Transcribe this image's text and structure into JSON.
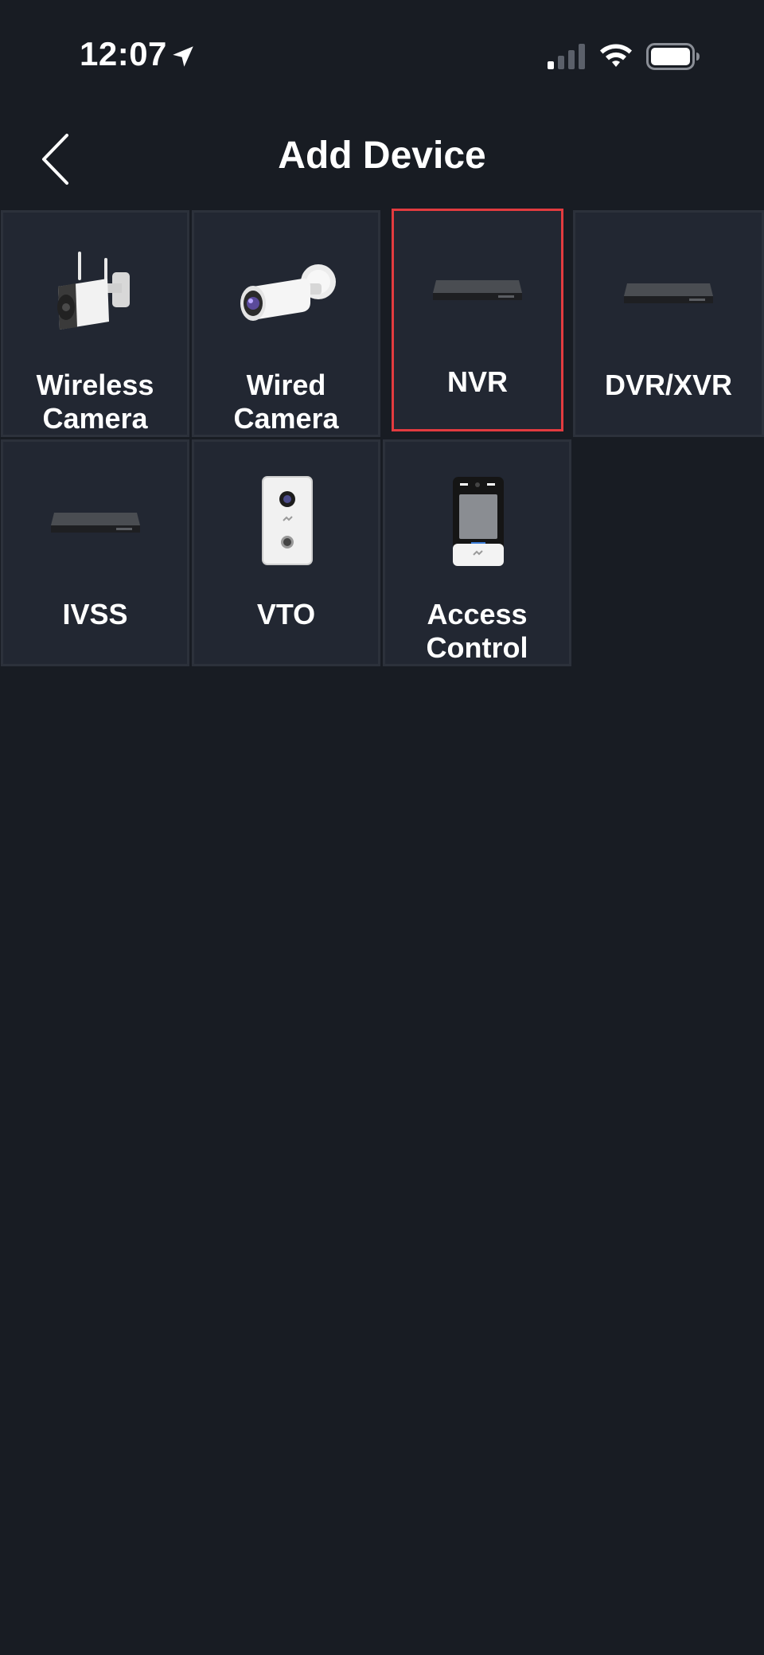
{
  "status_bar": {
    "time": "12:07",
    "icons": [
      "location-arrow-icon",
      "cellular-signal-icon",
      "wifi-icon",
      "battery-icon"
    ]
  },
  "header": {
    "title": "Add Device",
    "back_icon": "chevron-left-icon"
  },
  "devices": [
    {
      "label": "Wireless\nCamera",
      "icon": "wireless-camera-icon",
      "selected": false
    },
    {
      "label": "Wired\nCamera",
      "icon": "wired-camera-icon",
      "selected": false
    },
    {
      "label": "NVR",
      "icon": "nvr-icon",
      "selected": true
    },
    {
      "label": "DVR/XVR",
      "icon": "dvr-xvr-icon",
      "selected": false
    },
    {
      "label": "IVSS",
      "icon": "ivss-icon",
      "selected": false
    },
    {
      "label": "VTO",
      "icon": "vto-icon",
      "selected": false
    },
    {
      "label": "Access\nControl",
      "icon": "access-control-icon",
      "selected": false
    }
  ],
  "colors": {
    "background": "#181c23",
    "tile": "#222732",
    "tile_border": "#2c313b",
    "selected_border": "#e23b3f",
    "text": "#ffffff"
  }
}
